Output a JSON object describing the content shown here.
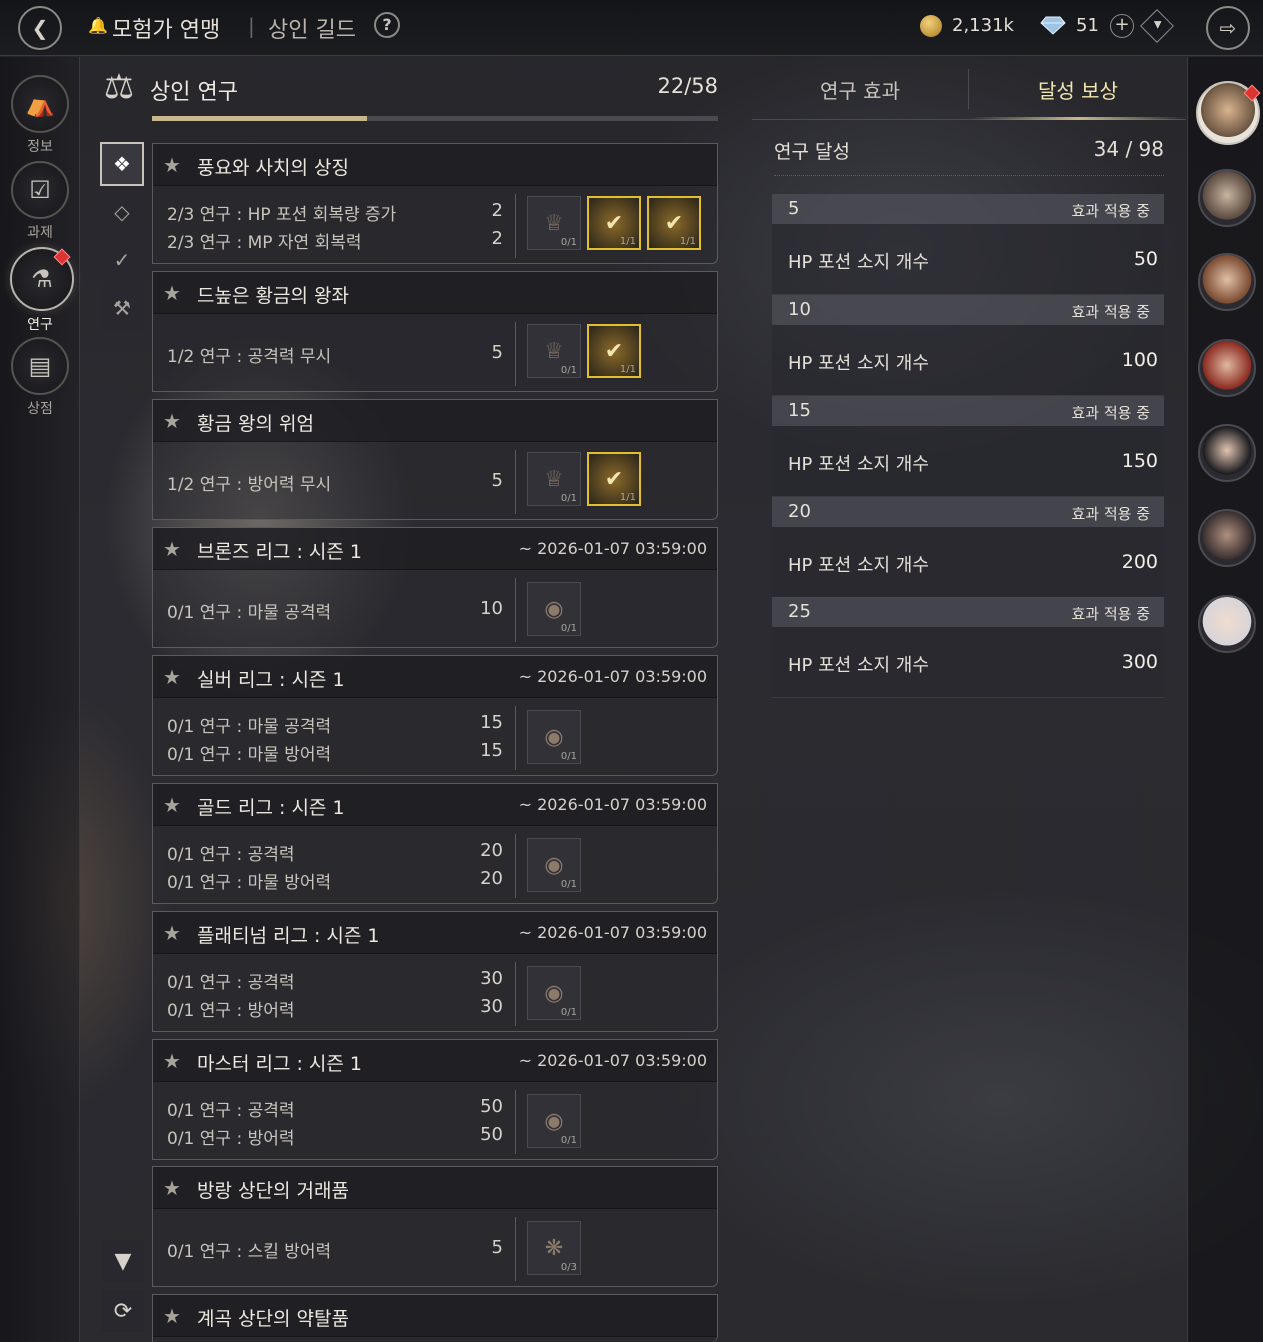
{
  "header": {
    "breadcrumb1": "모험가 연맹",
    "breadcrumb2": "상인 길드",
    "help": "?",
    "gold": "2,131k",
    "diamond": "51"
  },
  "nav": [
    {
      "label": "정보"
    },
    {
      "label": "과제"
    },
    {
      "label": "연구"
    },
    {
      "label": "상점"
    }
  ],
  "panel": {
    "title": "상인 연구",
    "count": "22/58",
    "progress": 0.379
  },
  "cards": [
    {
      "title": "풍요와 사치의 상징",
      "date": "",
      "lines": [
        {
          "text": "2/3 연구 : HP 포션 회복량 증가",
          "val": "2"
        },
        {
          "text": "2/3 연구 : MP 자연 회복력",
          "val": "2"
        }
      ],
      "rewards": [
        {
          "count": "0/1",
          "done": false
        },
        {
          "count": "1/1",
          "done": true
        },
        {
          "count": "1/1",
          "done": true
        }
      ]
    },
    {
      "title": "드높은 황금의 왕좌",
      "date": "",
      "lines": [
        {
          "text": "1/2 연구 : 공격력 무시",
          "val": "5"
        }
      ],
      "rewards": [
        {
          "count": "0/1",
          "done": false
        },
        {
          "count": "1/1",
          "done": true
        }
      ]
    },
    {
      "title": "황금 왕의 위엄",
      "date": "",
      "lines": [
        {
          "text": "1/2 연구 : 방어력 무시",
          "val": "5"
        }
      ],
      "rewards": [
        {
          "count": "0/1",
          "done": false
        },
        {
          "count": "1/1",
          "done": true
        }
      ]
    },
    {
      "title": "브론즈 리그 : 시즌 1",
      "date": "~ 2026-01-07 03:59:00",
      "lines": [
        {
          "text": "0/1 연구 : 마물 공격력",
          "val": "10"
        }
      ],
      "rewards": [
        {
          "count": "0/1",
          "done": false
        }
      ]
    },
    {
      "title": "실버 리그 : 시즌 1",
      "date": "~ 2026-01-07 03:59:00",
      "lines": [
        {
          "text": "0/1 연구 : 마물 공격력",
          "val": "15"
        },
        {
          "text": "0/1 연구 : 마물 방어력",
          "val": "15"
        }
      ],
      "rewards": [
        {
          "count": "0/1",
          "done": false
        }
      ]
    },
    {
      "title": "골드 리그 : 시즌 1",
      "date": "~ 2026-01-07 03:59:00",
      "lines": [
        {
          "text": "0/1 연구 : 공격력",
          "val": "20"
        },
        {
          "text": "0/1 연구 : 마물 방어력",
          "val": "20"
        }
      ],
      "rewards": [
        {
          "count": "0/1",
          "done": false
        }
      ]
    },
    {
      "title": "플래티넘 리그 : 시즌 1",
      "date": "~ 2026-01-07 03:59:00",
      "lines": [
        {
          "text": "0/1 연구 : 공격력",
          "val": "30"
        },
        {
          "text": "0/1 연구 : 방어력",
          "val": "30"
        }
      ],
      "rewards": [
        {
          "count": "0/1",
          "done": false
        }
      ]
    },
    {
      "title": "마스터 리그 : 시즌 1",
      "date": "~ 2026-01-07 03:59:00",
      "lines": [
        {
          "text": "0/1 연구 : 공격력",
          "val": "50"
        },
        {
          "text": "0/1 연구 : 방어력",
          "val": "50"
        }
      ],
      "rewards": [
        {
          "count": "0/1",
          "done": false
        }
      ]
    },
    {
      "title": "방랑 상단의 거래품",
      "date": "",
      "lines": [
        {
          "text": "0/1 연구 : 스킬 방어력",
          "val": "5"
        }
      ],
      "rewards": [
        {
          "count": "0/3",
          "done": false
        }
      ]
    },
    {
      "title": "계곡 상단의 약탈품",
      "date": "",
      "lines": [],
      "rewards": []
    }
  ],
  "right": {
    "tab1": "연구 효과",
    "tab2": "달성 보상",
    "ach_label": "연구 달성",
    "ach_value": "34 / 98",
    "tiers": [
      {
        "num": "5",
        "status": "효과 적용 중",
        "name": "HP 포션 소지 개수",
        "value": "50"
      },
      {
        "num": "10",
        "status": "효과 적용 중",
        "name": "HP 포션 소지 개수",
        "value": "100"
      },
      {
        "num": "15",
        "status": "효과 적용 중",
        "name": "HP 포션 소지 개수",
        "value": "150"
      },
      {
        "num": "20",
        "status": "효과 적용 중",
        "name": "HP 포션 소지 개수",
        "value": "200"
      },
      {
        "num": "25",
        "status": "효과 적용 중",
        "name": "HP 포션 소지 개수",
        "value": "300"
      }
    ]
  },
  "colors": {
    "accent_gold": "#c8b78e",
    "done_border": "#e0c030",
    "alert_red": "#dd3333"
  }
}
